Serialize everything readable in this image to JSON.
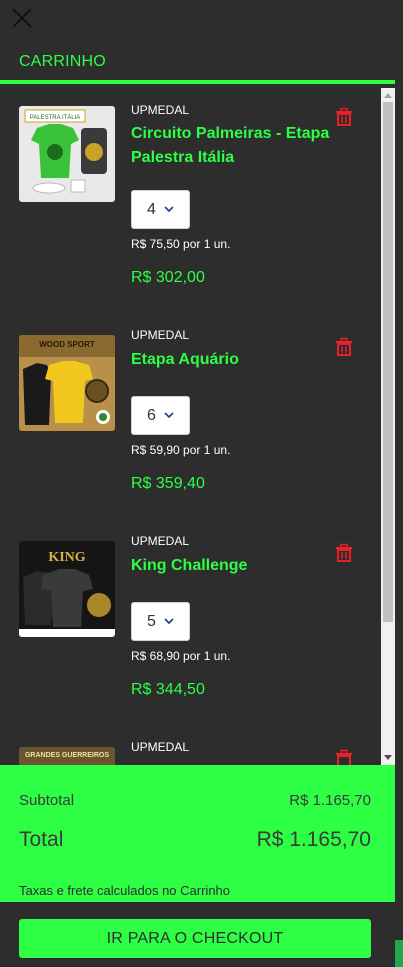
{
  "header": {
    "title": "CARRINHO"
  },
  "items": [
    {
      "brand": "UPMEDAL",
      "name": "Circuito Palmeiras - Etapa Palestra Itália",
      "quantity": "4",
      "unit_price": "R$ 75,50 por 1 un.",
      "line_total": "R$ 302,00",
      "image_text": "PALESTRA ITÁLIA"
    },
    {
      "brand": "UPMEDAL",
      "name": "Etapa Aquário",
      "quantity": "6",
      "unit_price": "R$ 59,90 por 1 un.",
      "line_total": "R$ 359,40",
      "image_text": "WOOD SPORT"
    },
    {
      "brand": "UPMEDAL",
      "name": "King Challenge",
      "quantity": "5",
      "unit_price": "R$ 68,90 por 1 un.",
      "line_total": "R$ 344,50",
      "image_text": "KING"
    },
    {
      "brand": "UPMEDAL",
      "image_text": "GRANDES GUERREIROS"
    }
  ],
  "summary": {
    "subtotal_label": "Subtotal",
    "subtotal_value": "R$ 1.165,70",
    "total_label": "Total",
    "total_value": "R$ 1.165,70",
    "taxes_note": "Taxas e frete calculados no Carrinho"
  },
  "checkout": {
    "label": "IR PARA O CHECKOUT"
  },
  "colors": {
    "accent": "#2cff44",
    "background": "#2d2d2d",
    "delete": "#e8202a"
  }
}
